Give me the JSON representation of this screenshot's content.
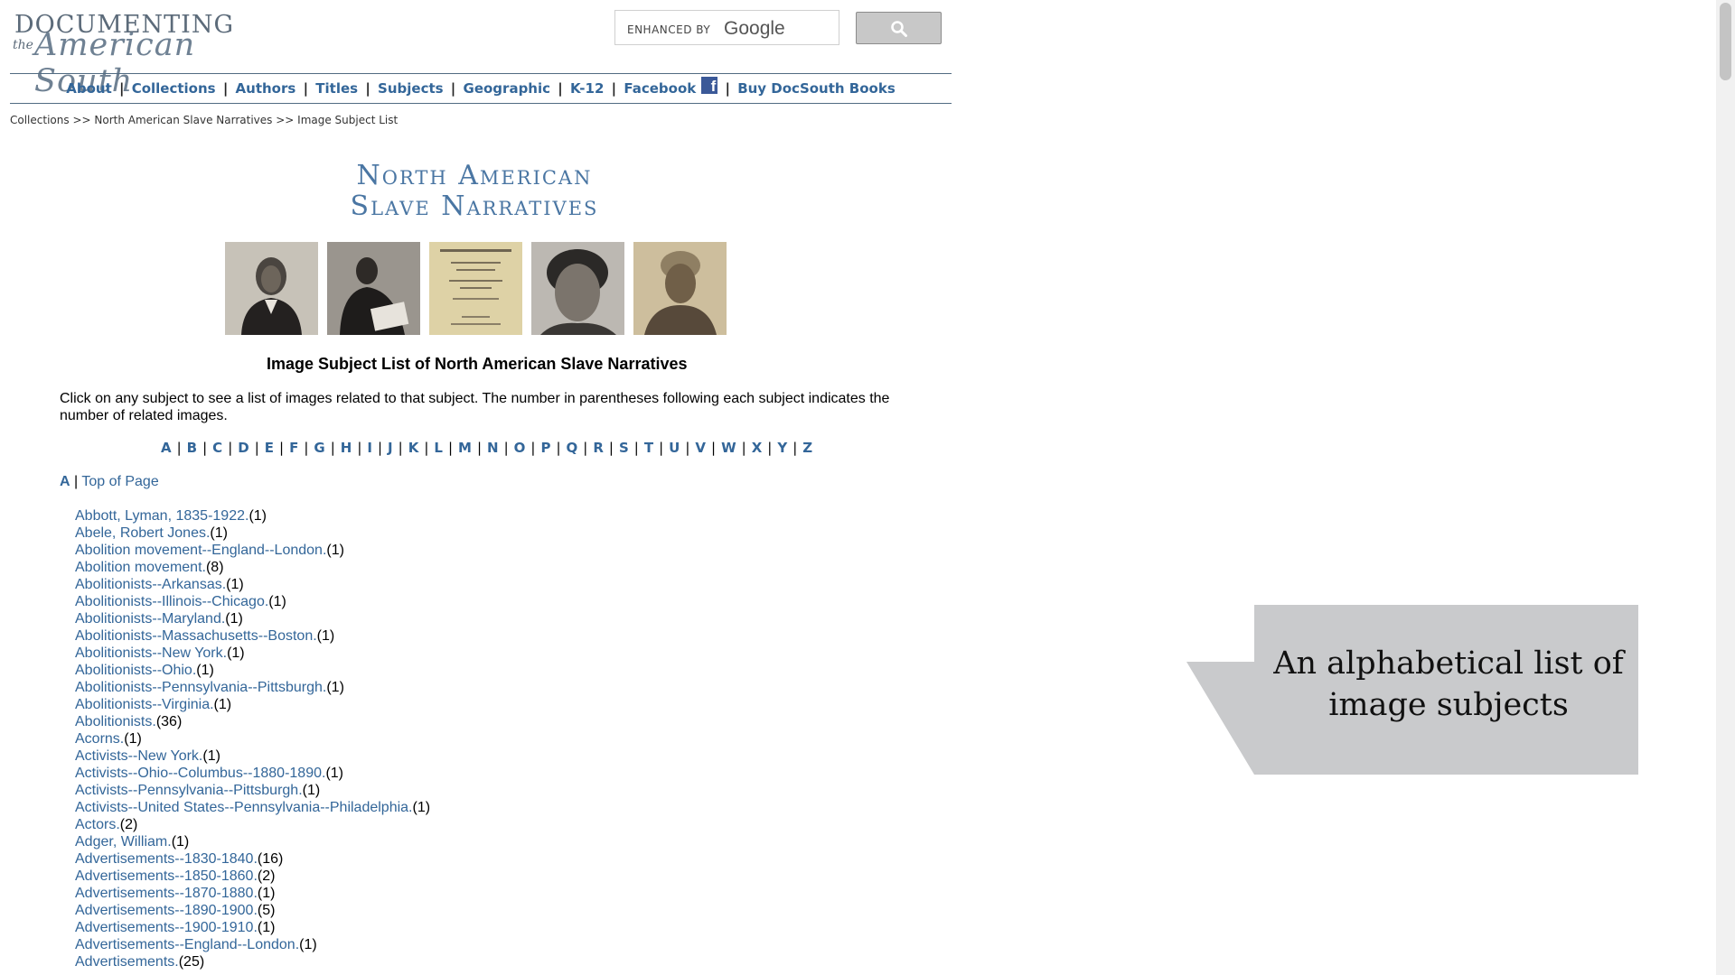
{
  "header": {
    "logo": {
      "line1": "DOCUMENTING",
      "line2": "the",
      "line3": "American South"
    },
    "search": {
      "placeholder": "ENHANCED BY",
      "brand": "Google"
    }
  },
  "nav": {
    "items": [
      {
        "label": "About"
      },
      {
        "label": "Collections"
      },
      {
        "label": "Authors"
      },
      {
        "label": "Titles"
      },
      {
        "label": "Subjects"
      },
      {
        "label": "Geographic"
      },
      {
        "label": "K-12"
      },
      {
        "label": "Facebook"
      },
      {
        "label": "Buy DocSouth Books"
      }
    ],
    "separator": "|",
    "facebook_icon": "facebook-icon"
  },
  "breadcrumb": {
    "items": [
      "Collections",
      "North American Slave Narratives",
      "Image Subject List"
    ],
    "separator": ">>"
  },
  "collection": {
    "title_line1": "North American",
    "title_line2": "Slave Narratives",
    "photos": [
      "portrait-woman-bonnet",
      "portrait-man-reading",
      "title-page-narrative",
      "portrait-woman-close",
      "portrait-woman-headwrap"
    ]
  },
  "page": {
    "title": "Image Subject List of North American Slave Narratives",
    "intro": "Click on any subject to see a list of images related to that subject. The number in parentheses following each subject indicates the number of related images."
  },
  "alphabet": [
    "A",
    "B",
    "C",
    "D",
    "E",
    "F",
    "G",
    "H",
    "I",
    "J",
    "K",
    "L",
    "M",
    "N",
    "O",
    "P",
    "Q",
    "R",
    "S",
    "T",
    "U",
    "V",
    "W",
    "X",
    "Y",
    "Z"
  ],
  "section": {
    "letter": "A",
    "separator": "|",
    "top_link": "Top of Page"
  },
  "subjects": [
    {
      "name": "Abbott, Lyman, 1835-1922.",
      "count": "(1)"
    },
    {
      "name": "Abele, Robert Jones.",
      "count": "(1)"
    },
    {
      "name": "Abolition movement--England--London.",
      "count": "(1)"
    },
    {
      "name": "Abolition movement.",
      "count": "(8)"
    },
    {
      "name": "Abolitionists--Arkansas.",
      "count": "(1)"
    },
    {
      "name": "Abolitionists--Illinois--Chicago.",
      "count": "(1)"
    },
    {
      "name": "Abolitionists--Maryland.",
      "count": "(1)"
    },
    {
      "name": "Abolitionists--Massachusetts--Boston.",
      "count": "(1)"
    },
    {
      "name": "Abolitionists--New York.",
      "count": "(1)"
    },
    {
      "name": "Abolitionists--Ohio.",
      "count": "(1)"
    },
    {
      "name": "Abolitionists--Pennsylvania--Pittsburgh.",
      "count": "(1)"
    },
    {
      "name": "Abolitionists--Virginia.",
      "count": "(1)"
    },
    {
      "name": "Abolitionists.",
      "count": "(36)"
    },
    {
      "name": "Acorns.",
      "count": "(1)"
    },
    {
      "name": "Activists--New York.",
      "count": "(1)"
    },
    {
      "name": "Activists--Ohio--Columbus--1880-1890.",
      "count": "(1)"
    },
    {
      "name": "Activists--Pennsylvania--Pittsburgh.",
      "count": "(1)"
    },
    {
      "name": "Activists--United States--Pennsylvania--Philadelphia.",
      "count": "(1)"
    },
    {
      "name": "Actors.",
      "count": "(2)"
    },
    {
      "name": "Adger, William.",
      "count": "(1)"
    },
    {
      "name": "Advertisements--1830-1840.",
      "count": "(16)"
    },
    {
      "name": "Advertisements--1850-1860.",
      "count": "(2)"
    },
    {
      "name": "Advertisements--1870-1880.",
      "count": "(1)"
    },
    {
      "name": "Advertisements--1890-1900.",
      "count": "(5)"
    },
    {
      "name": "Advertisements--1900-1910.",
      "count": "(1)"
    },
    {
      "name": "Advertisements--England--London.",
      "count": "(1)"
    },
    {
      "name": "Advertisements.",
      "count": "(25)"
    }
  ],
  "callout": {
    "text": "An alphabetical list of image subjects",
    "color": "#c9cacc"
  }
}
